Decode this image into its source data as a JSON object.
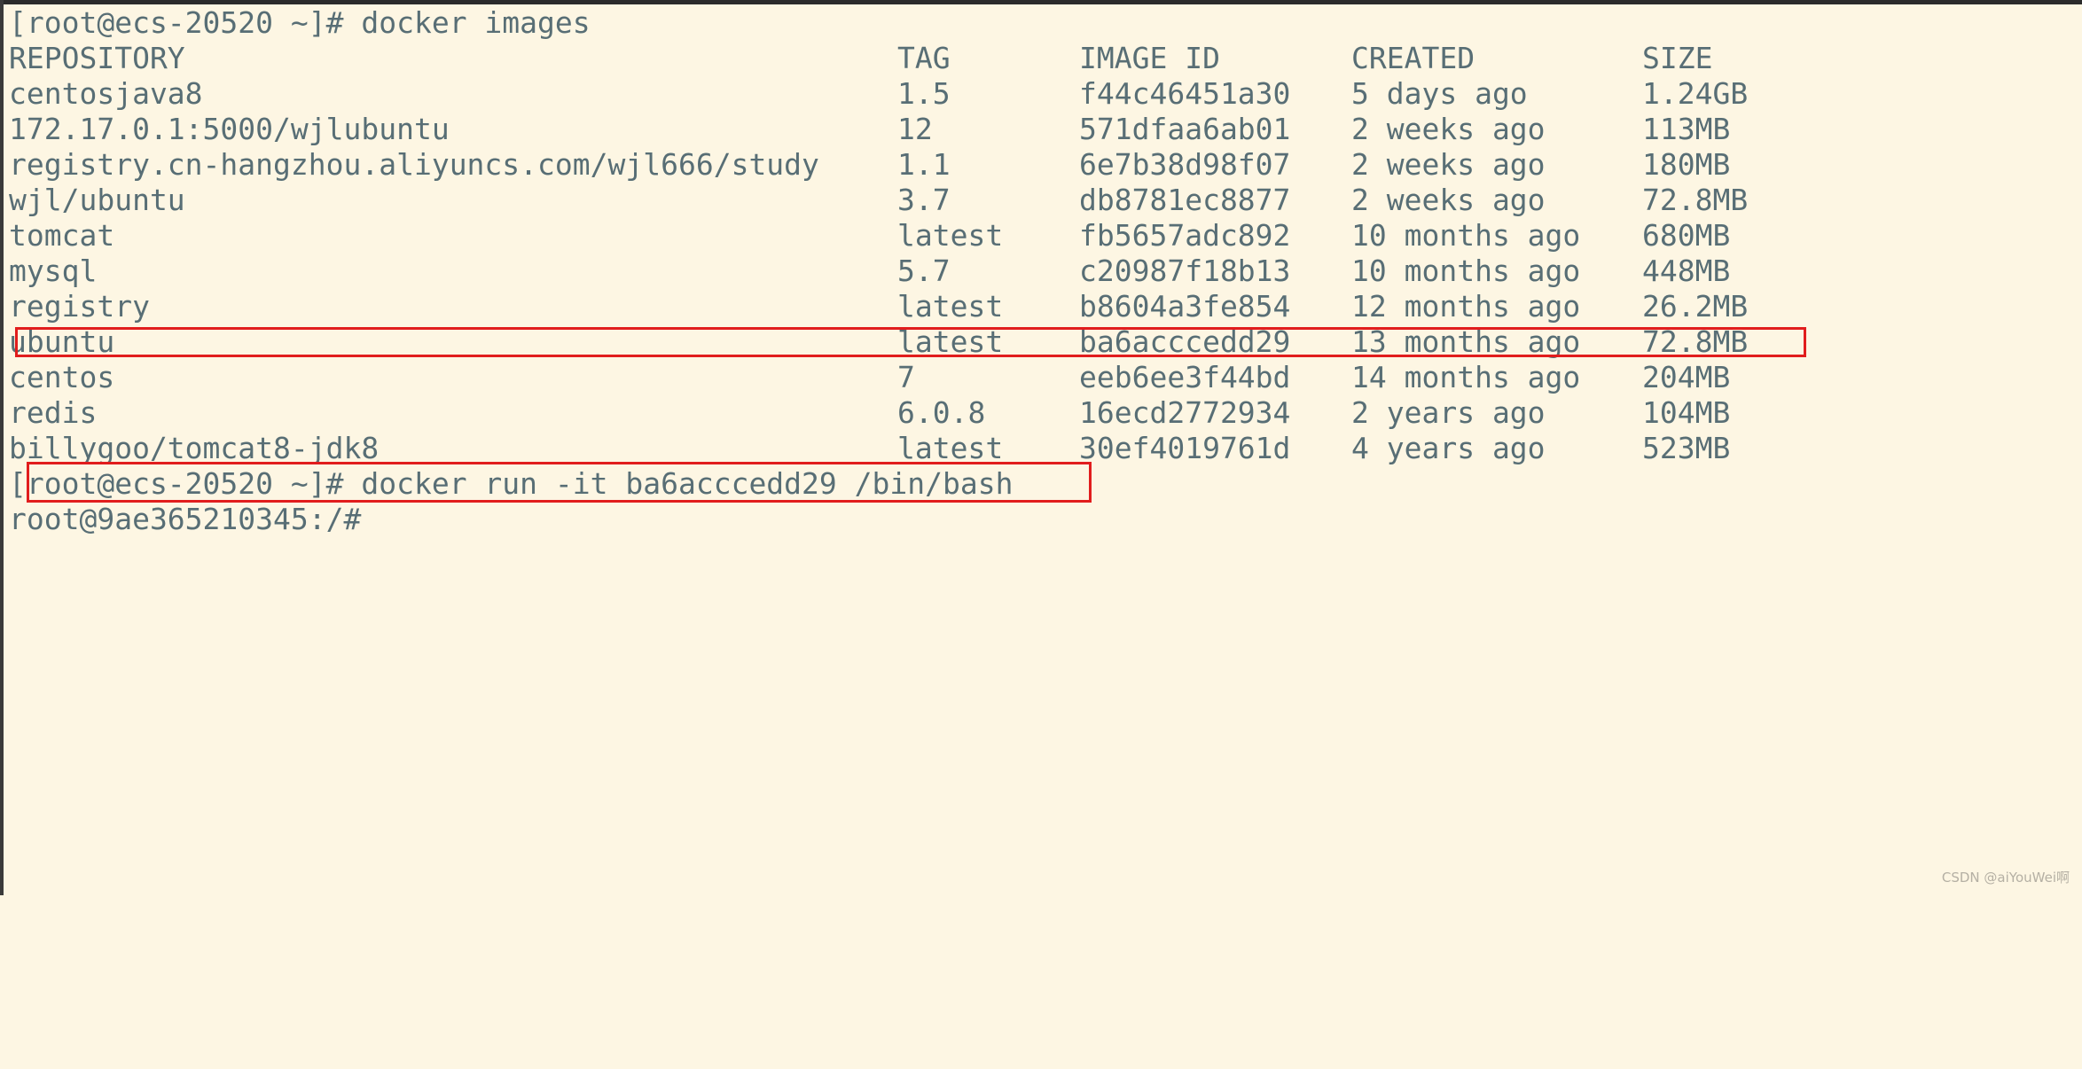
{
  "terminal": {
    "prompt_1": "[root@ecs-20520 ~]# docker images",
    "header": {
      "repository": "REPOSITORY",
      "tag": "TAG",
      "image_id": "IMAGE ID",
      "created": "CREATED",
      "size": "SIZE"
    },
    "images": [
      {
        "repository": "centosjava8",
        "tag": "1.5",
        "image_id": "f44c46451a30",
        "created": "5 days ago",
        "size": "1.24GB"
      },
      {
        "repository": "172.17.0.1:5000/wjlubuntu",
        "tag": "12",
        "image_id": "571dfaa6ab01",
        "created": "2 weeks ago",
        "size": "113MB"
      },
      {
        "repository": "registry.cn-hangzhou.aliyuncs.com/wjl666/study",
        "tag": "1.1",
        "image_id": "6e7b38d98f07",
        "created": "2 weeks ago",
        "size": "180MB"
      },
      {
        "repository": "wjl/ubuntu",
        "tag": "3.7",
        "image_id": "db8781ec8877",
        "created": "2 weeks ago",
        "size": "72.8MB"
      },
      {
        "repository": "tomcat",
        "tag": "latest",
        "image_id": "fb5657adc892",
        "created": "10 months ago",
        "size": "680MB"
      },
      {
        "repository": "mysql",
        "tag": "5.7",
        "image_id": "c20987f18b13",
        "created": "10 months ago",
        "size": "448MB"
      },
      {
        "repository": "registry",
        "tag": "latest",
        "image_id": "b8604a3fe854",
        "created": "12 months ago",
        "size": "26.2MB"
      },
      {
        "repository": "ubuntu",
        "tag": "latest",
        "image_id": "ba6acccedd29",
        "created": "13 months ago",
        "size": "72.8MB"
      },
      {
        "repository": "centos",
        "tag": "7",
        "image_id": "eeb6ee3f44bd",
        "created": "14 months ago",
        "size": "204MB"
      },
      {
        "repository": "redis",
        "tag": "6.0.8",
        "image_id": "16ecd2772934",
        "created": "2 years ago",
        "size": "104MB"
      },
      {
        "repository": "billygoo/tomcat8-jdk8",
        "tag": "latest",
        "image_id": "30ef4019761d",
        "created": "4 years ago",
        "size": "523MB"
      }
    ],
    "prompt_2": "[root@ecs-20520 ~]# docker run -it ba6acccedd29 /bin/bash",
    "prompt_3": "root@9ae365210345:/#"
  },
  "watermark": "CSDN @aiYouWei啊",
  "colors": {
    "background": "#fdf6e3",
    "text": "#586e75",
    "highlight_box": "#e11d1d"
  }
}
